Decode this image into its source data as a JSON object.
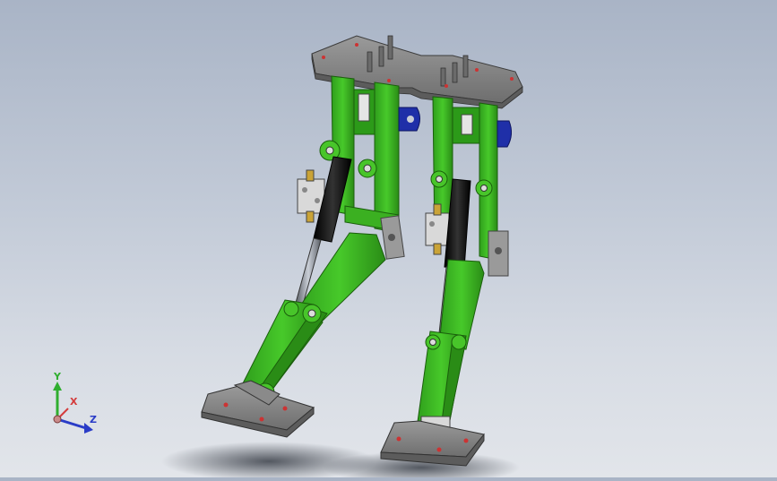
{
  "viewport": {
    "background_top": "#a9b4c6",
    "background_bottom": "#e2e5ea",
    "part_color": "#3dbb23",
    "part_shadow_color": "#2a8c16",
    "plate_color": "#8d8d8d",
    "cylinder_color": "#111111",
    "bracket_color": "#1f2fa8"
  },
  "triad": {
    "y_label": "Y",
    "x_label": "X",
    "z_label": "Z",
    "y_color": "#2fae2f",
    "x_color": "#d43c3c",
    "z_color": "#2a3cc7"
  }
}
